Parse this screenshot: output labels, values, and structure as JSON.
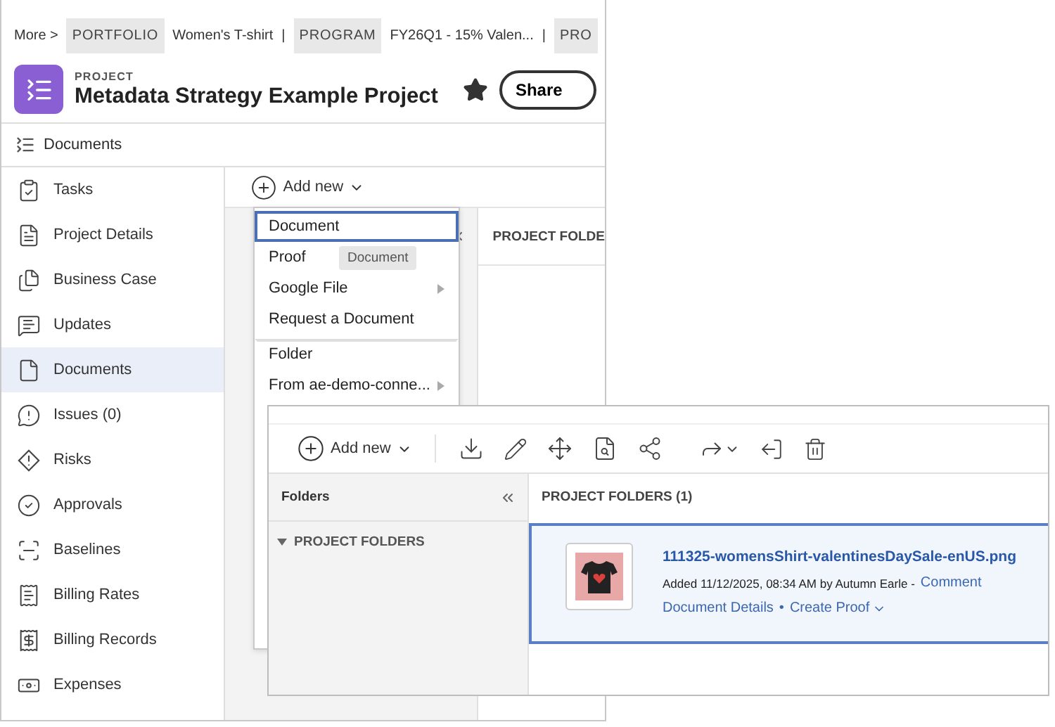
{
  "back_window": {
    "breadcrumb": {
      "more": "More >",
      "items": [
        {
          "kind": "tag",
          "label": "PORTFOLIO"
        },
        {
          "kind": "text",
          "label": "Women's T-shirt"
        },
        {
          "kind": "separator",
          "label": "|"
        },
        {
          "kind": "tag",
          "label": "PROGRAM"
        },
        {
          "kind": "text",
          "label": "FY26Q1 - 15% Valen..."
        },
        {
          "kind": "separator",
          "label": "|"
        },
        {
          "kind": "tag",
          "label": "PRO"
        }
      ]
    },
    "project": {
      "type_label": "PROJECT",
      "title": "Metadata Strategy Example Project",
      "favorite": true,
      "share_button": "Share"
    },
    "nav_header": "Documents",
    "sidebar": {
      "items": [
        {
          "label": "Tasks",
          "selected": false
        },
        {
          "label": "Project Details",
          "selected": false
        },
        {
          "label": "Business Case",
          "selected": false
        },
        {
          "label": "Updates",
          "selected": false
        },
        {
          "label": "Documents",
          "selected": true
        },
        {
          "label": "Issues (0)",
          "selected": false
        },
        {
          "label": "Risks",
          "selected": false
        },
        {
          "label": "Approvals",
          "selected": false
        },
        {
          "label": "Baselines",
          "selected": false
        },
        {
          "label": "Billing Rates",
          "selected": false
        },
        {
          "label": "Billing Records",
          "selected": false
        },
        {
          "label": "Expenses",
          "selected": false
        }
      ]
    },
    "toolbar": {
      "add_new": "Add new"
    },
    "folders_header": "PROJECT FOLDE",
    "dropdown": {
      "items": [
        {
          "label": "Document",
          "selected": true,
          "submenu": false,
          "divider_before": false
        },
        {
          "label": "Proof",
          "selected": false,
          "submenu": false,
          "divider_before": false
        },
        {
          "label": "Google File",
          "selected": false,
          "submenu": true,
          "divider_before": false
        },
        {
          "label": "Request a Document",
          "selected": false,
          "submenu": false,
          "divider_before": false
        },
        {
          "label": "Folder",
          "selected": false,
          "submenu": false,
          "divider_before": true
        },
        {
          "label": "From ae-demo-conne...",
          "selected": false,
          "submenu": true,
          "divider_before": false
        }
      ]
    },
    "tooltip": "Document"
  },
  "front_window": {
    "toolbar": {
      "add_new": "Add new"
    },
    "folders_panel": {
      "title": "Folders",
      "tree": [
        {
          "label": "PROJECT FOLDERS",
          "expanded": true
        }
      ]
    },
    "content": {
      "header": "PROJECT FOLDERS (1)",
      "file": {
        "name": "111325-womensShirt-valentinesDaySale-enUS.png",
        "selected": true,
        "meta": "Added 11/12/2025, 08:34 AM by Autumn Earle -",
        "comment_link": "Comment",
        "actions": [
          "Document Details",
          "Create Proof"
        ],
        "action_separator": "•"
      }
    }
  }
}
